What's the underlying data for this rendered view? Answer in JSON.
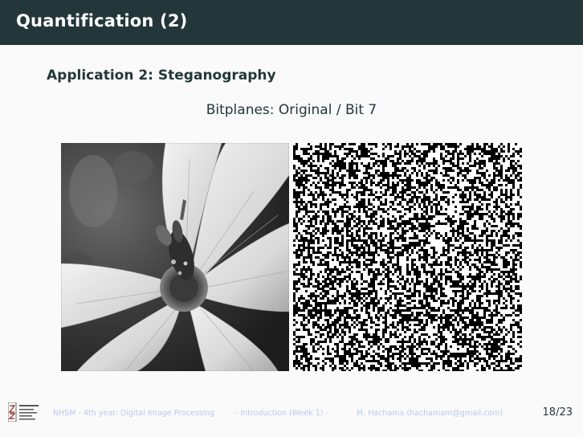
{
  "slide": {
    "title": "Quantification (2)",
    "subtitle": "Application 2: Steganography",
    "caption": "Bitplanes: Original / Bit 7"
  },
  "images": {
    "original": "grayscale-flower-with-bee",
    "bitplane": "bit-7-plane-binary-noise"
  },
  "footer": {
    "course": "NHSM - 4th year: Digital Image Processing",
    "section": "- Introduction (Week 1) -",
    "author": "M. Hachama (hachamam@gmail.com)",
    "page": "18/23"
  },
  "colors": {
    "header_bg": "#23373b",
    "footer_text": "#b8c8ec",
    "page_bg": "#fafafa"
  }
}
